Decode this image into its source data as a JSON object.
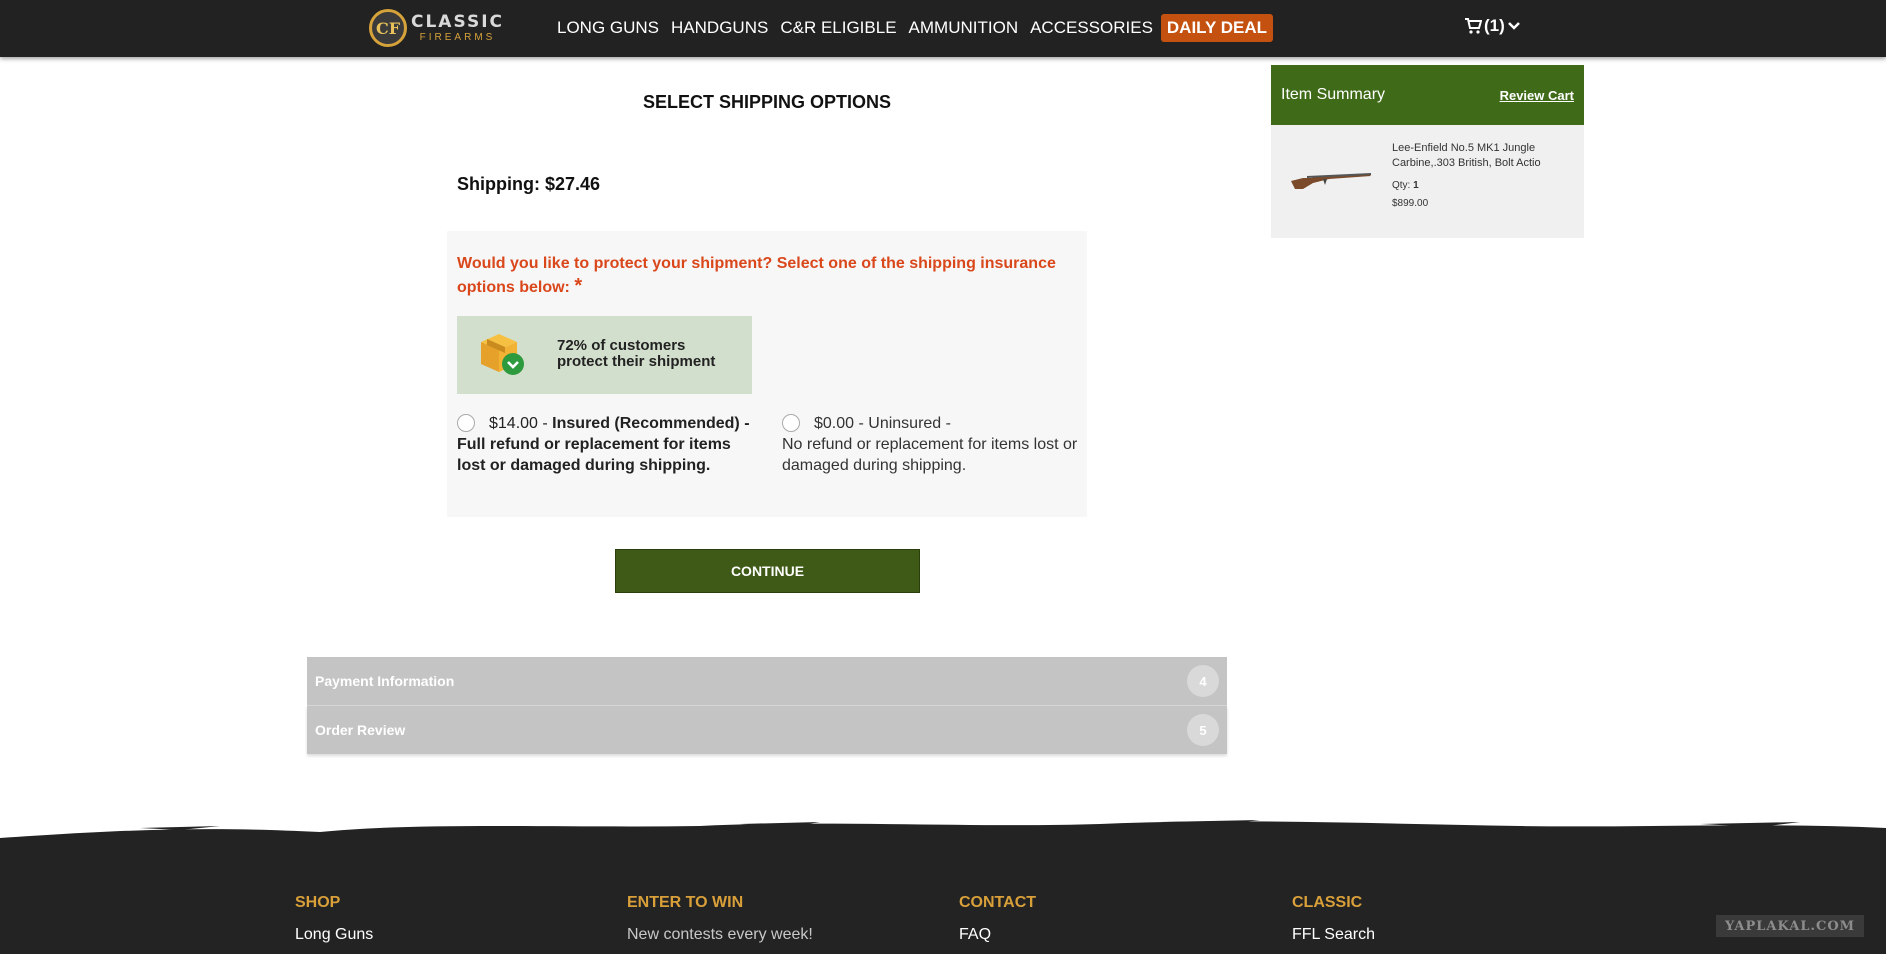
{
  "header": {
    "logo": {
      "badge": "CF",
      "line1": "CLASSIC",
      "line2": "FIREARMS"
    },
    "nav": [
      "LONG GUNS",
      "HANDGUNS",
      "C&R ELIGIBLE",
      "AMMUNITION",
      "ACCESSORIES",
      "DAILY DEAL"
    ],
    "cart": {
      "count": "(1)",
      "icon": "cart-icon"
    }
  },
  "main": {
    "title": "SELECT SHIPPING OPTIONS",
    "shipping": "Shipping: $27.46",
    "question": "Would you like to protect your shipment? Select one of the shipping insurance options below:",
    "required_mark": "*",
    "stat": {
      "line1": "72% of customers",
      "line2": "protect their shipment",
      "icon": "box-check-icon"
    },
    "options": [
      {
        "price": "$14.00 -",
        "title": "Insured (Recommended) -",
        "desc": "Full refund or replacement for items lost or damaged during shipping.",
        "selected": false
      },
      {
        "price": "$0.00 -",
        "title": "Uninsured -",
        "desc": "No refund or replacement for items lost or damaged during shipping.",
        "selected": false
      }
    ],
    "continue_label": "CONTINUE",
    "steps": [
      {
        "label": "Payment Information",
        "num": "4"
      },
      {
        "label": "Order Review",
        "num": "5"
      }
    ]
  },
  "summary": {
    "title": "Item Summary",
    "review": "Review Cart",
    "item_name_1": "Lee-Enfield No.5 MK1 Jungle",
    "item_name_2": "Carbine,.303 British, Bolt Actio",
    "qty_label": "Qty:",
    "qty": "1",
    "price": "$899.00"
  },
  "footer": {
    "columns": [
      {
        "head": "SHOP",
        "link": "Long Guns"
      },
      {
        "head": "ENTER TO WIN",
        "link": "New contests every week!"
      },
      {
        "head": "CONTACT",
        "link": "FAQ"
      },
      {
        "head": "CLASSIC",
        "link": "FFL Search"
      }
    ],
    "watermark": "YAPLAKAL.COM"
  },
  "colors": {
    "header_bg": "#222222",
    "accent_green": "#3f6b19",
    "deal_orange": "#c4510f",
    "question_red": "#d9471b",
    "footer_gold": "#d9a03a"
  }
}
